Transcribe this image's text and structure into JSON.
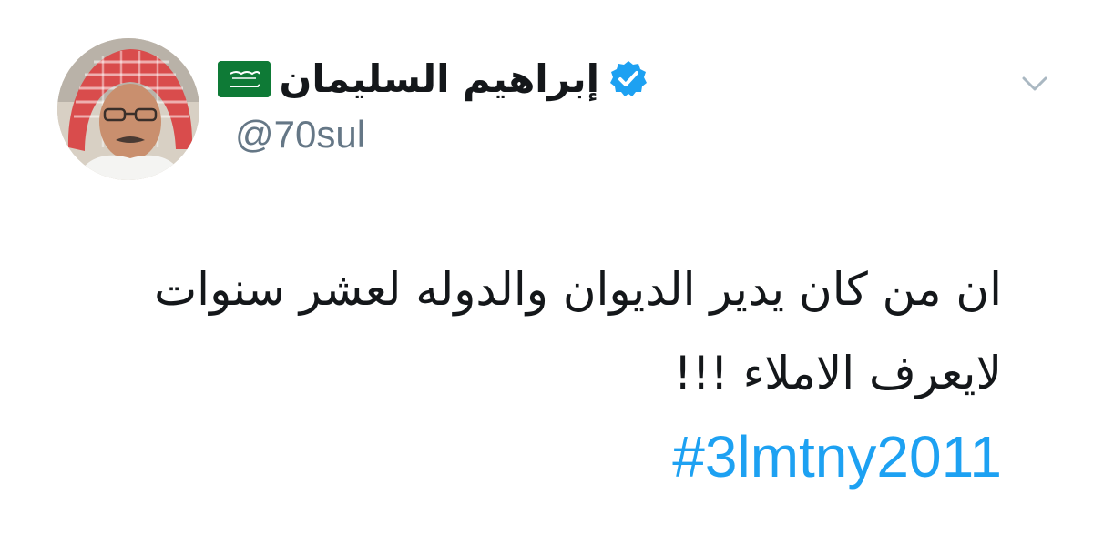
{
  "tweet": {
    "author": {
      "display_name": "إبراهيم السليمان",
      "handle": "@70sul",
      "flag_icon": "saudi-flag-icon",
      "verified_icon": "verified-badge-icon",
      "verified_color": "#1da1f2",
      "avatar_icon": "profile-photo"
    },
    "menu_icon": "chevron-down-icon",
    "text_lines": [
      "ان من كان يدير الديوان والدوله لعشر سنوات",
      "لايعرف الاملاء !!!"
    ],
    "hashtag": "#3lmtny2011",
    "colors": {
      "text": "#14171a",
      "handle": "#657786",
      "link": "#1da1f2",
      "background": "#ffffff"
    }
  }
}
